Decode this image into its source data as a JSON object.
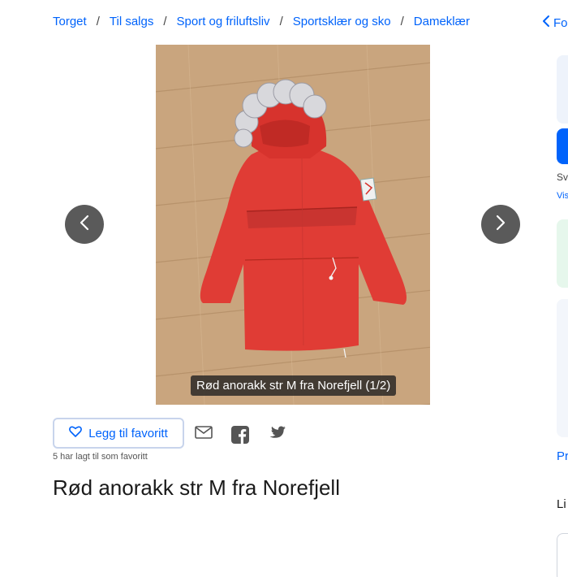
{
  "breadcrumb": {
    "items": [
      "Torget",
      "Til salgs",
      "Sport og friluftsliv",
      "Sportsklær og sko",
      "Dameklær"
    ],
    "separator": "/"
  },
  "sidebar": {
    "back_label": "Fo",
    "text_sv": "Sv",
    "text_vis": "Vis",
    "text_pr": "Pr",
    "text_li": "Li"
  },
  "gallery": {
    "caption": "Rød anorakk str M fra Norefjell (1/2)",
    "prev_icon": "chevron-left-icon",
    "next_icon": "chevron-right-icon"
  },
  "actions": {
    "favorite_label": "Legg til favoritt",
    "favorite_count_text": "5 har lagt til som favoritt",
    "share_icons": [
      "mail-icon",
      "facebook-icon",
      "twitter-icon"
    ]
  },
  "ad": {
    "title": "Rød anorakk str M fra Norefjell"
  },
  "colors": {
    "link": "#0063fb",
    "jacket": "#e03c35",
    "floor": "#c9a57e"
  }
}
